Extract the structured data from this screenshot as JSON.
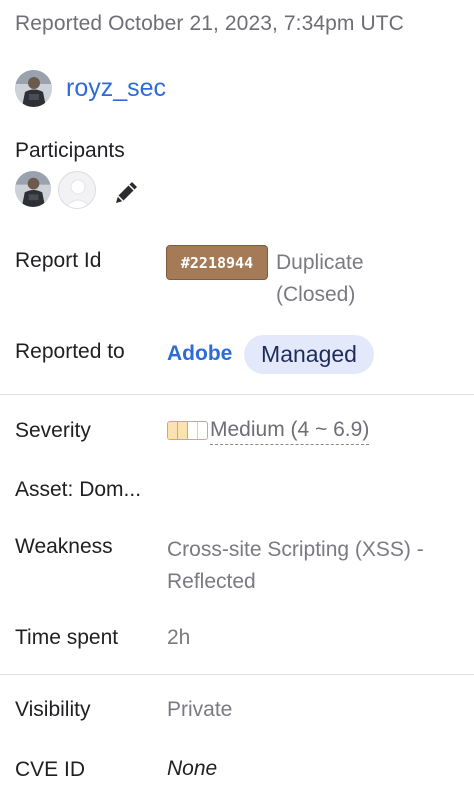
{
  "header": {
    "reported_text": "Reported October 21, 2023, 7:34pm UTC"
  },
  "reporter": {
    "username": "royz_sec"
  },
  "participants": {
    "label": "Participants"
  },
  "report": {
    "label": "Report Id",
    "id": "#2218944",
    "status_line1": "Duplicate",
    "status_line2": "(Closed)"
  },
  "reported_to": {
    "label": "Reported to",
    "program": "Adobe",
    "tag": "Managed"
  },
  "severity": {
    "label": "Severity",
    "value": "Medium (4 ~ 6.9)"
  },
  "asset": {
    "label": "Asset: Dom..."
  },
  "weakness": {
    "label": "Weakness",
    "line1": "Cross-site Scripting (XSS) -",
    "line2": "Reflected"
  },
  "time_spent": {
    "label": "Time spent",
    "value": "2h"
  },
  "visibility": {
    "label": "Visibility",
    "value": "Private"
  },
  "cve": {
    "label": "CVE ID",
    "value": "None"
  },
  "colors": {
    "link": "#2d6bd6",
    "report_badge": "#a47a57",
    "managed_tag_bg": "#e3e9fb",
    "severity_medium": "#e8a63c"
  }
}
